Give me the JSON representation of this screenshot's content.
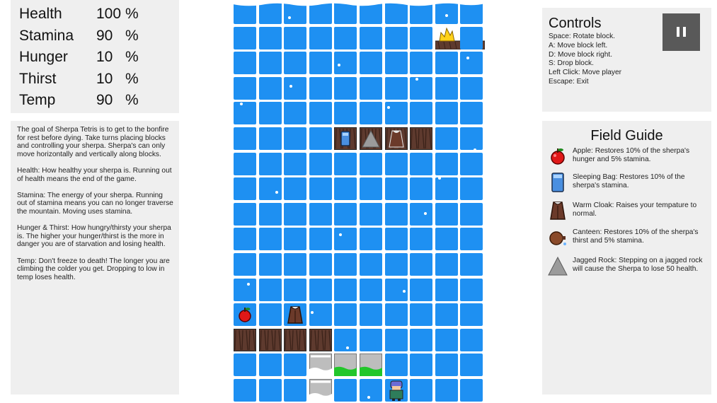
{
  "stats": [
    {
      "label": "Health",
      "value": "100",
      "unit": "%"
    },
    {
      "label": "Stamina",
      "value": "90",
      "unit": "%"
    },
    {
      "label": "Hunger",
      "value": "10",
      "unit": "%"
    },
    {
      "label": "Thirst",
      "value": "10",
      "unit": "%"
    },
    {
      "label": "Temp",
      "value": "90",
      "unit": "%"
    }
  ],
  "description": [
    "The goal of Sherpa Tetris is to get to the bonfire for rest before dying. Take turns placing blocks and controlling your sherpa. Sherpa's can only move horizontally and vertically along blocks.",
    "Health: How healthy your sherpa is. Running out of health means the end of the game.",
    "Stamina: The energy of your sherpa. Running out of stamina means you can no longer traverse the mountain. Moving uses stamina.",
    "Hunger & Thirst: How hungry/thirsty your sherpa is. The higher your hunger/thirst is the more in danger you are of starvation and losing health.",
    "Temp: Don't freeze to death! The longer you are climbing the colder you get. Dropping to low in temp loses health."
  ],
  "controls": {
    "title": "Controls",
    "items": [
      "Space: Rotate block.",
      "A:  Move block left.",
      "D:  Move block right.",
      "S:  Drop block.",
      "Left Click: Move player",
      "Escape: Exit"
    ],
    "pause_icon": "pause-icon"
  },
  "guide": {
    "title": "Field Guide",
    "entries": [
      {
        "icon": "apple-icon",
        "text": "Apple: Restores 10% of the sherpa's hunger and 5% stamina."
      },
      {
        "icon": "sleeping-bag-icon",
        "text": "Sleeping Bag: Restores 10% of the sherpa's stamina."
      },
      {
        "icon": "warm-cloak-icon",
        "text": "Warm Cloak: Raises your tempature to normal."
      },
      {
        "icon": "canteen-icon",
        "text": "Canteen: Restores 10% of the sherpa's thirst and 5% stamina."
      },
      {
        "icon": "jagged-rock-icon",
        "text": "Jagged Rock: Stepping on a jagged rock will cause the Sherpa to lose 50 health."
      }
    ]
  },
  "board": {
    "columns": 10,
    "rows": 16,
    "colors": {
      "sky": "#1e90f2",
      "wood": "#5e3a2e",
      "grass": "#22c62a",
      "stone": "#bdbdbd",
      "fire": "#ffd21a"
    },
    "tiles": [
      {
        "type": "bonfire",
        "col": 8,
        "row": 1
      },
      {
        "type": "sleeping-bag",
        "col": 4,
        "row": 5
      },
      {
        "type": "jagged-rock",
        "col": 5,
        "row": 5
      },
      {
        "type": "warm-cloak",
        "col": 6,
        "row": 5
      },
      {
        "type": "wood",
        "col": 7,
        "row": 5
      },
      {
        "type": "apple",
        "col": 0,
        "row": 12
      },
      {
        "type": "warm-cloak",
        "col": 2,
        "row": 12
      },
      {
        "type": "wood",
        "col": 0,
        "row": 13
      },
      {
        "type": "wood",
        "col": 1,
        "row": 13
      },
      {
        "type": "wood",
        "col": 2,
        "row": 13
      },
      {
        "type": "wood",
        "col": 3,
        "row": 13
      },
      {
        "type": "snow-stone",
        "col": 3,
        "row": 14
      },
      {
        "type": "grass-stone",
        "col": 4,
        "row": 14
      },
      {
        "type": "grass-stone",
        "col": 5,
        "row": 14
      },
      {
        "type": "snow-stone",
        "col": 3,
        "row": 15
      },
      {
        "type": "sherpa",
        "col": 6,
        "row": 15
      }
    ]
  }
}
